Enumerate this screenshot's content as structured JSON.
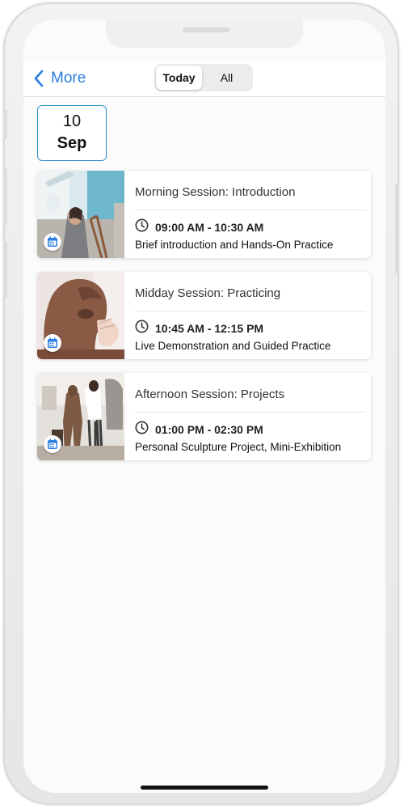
{
  "nav": {
    "back_label": "More",
    "segments": [
      "Today",
      "All"
    ],
    "selected_segment": "Today"
  },
  "date": {
    "day": "10",
    "month": "Sep"
  },
  "sessions": [
    {
      "title": "Morning Session: Introduction",
      "time": "09:00 AM - 10:30 AM",
      "description": "Brief introduction and Hands-On Practice"
    },
    {
      "title": "Midday Session: Practicing",
      "time": "10:45 AM - 12:15 PM",
      "description": "Live Demonstration and Guided Practice"
    },
    {
      "title": "Afternoon Session: Projects",
      "time": "01:00 PM - 02:30 PM",
      "description": "Personal Sculpture Project, Mini-Exhibition"
    }
  ],
  "colors": {
    "accent": "#2a7de1",
    "date_border": "#2a8fc8",
    "badge_icon": "#2a7de1"
  },
  "icons": {
    "back": "chevron-left-icon",
    "clock": "clock-icon",
    "badge": "calendar-icon"
  }
}
